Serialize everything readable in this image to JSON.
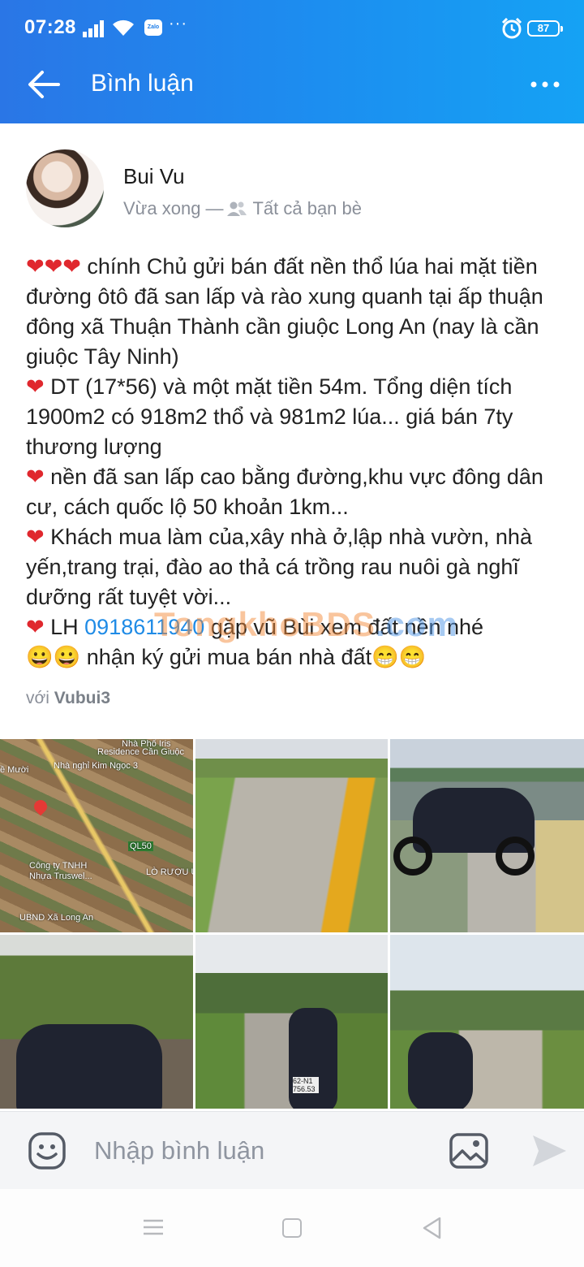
{
  "status_bar": {
    "time": "07:28",
    "notification_app": "Zalo",
    "more_indicator": "···",
    "battery": "87",
    "icons": [
      "signal-icon",
      "wifi-icon",
      "zalo-icon",
      "alarm-icon",
      "battery-icon"
    ]
  },
  "header": {
    "title": "Bình luận",
    "back_icon": "back-arrow-icon",
    "more_icon": "more-horizontal-icon",
    "gradient_colors": [
      "#2a76e6",
      "#15a2f4"
    ]
  },
  "post": {
    "author": "Bui Vu",
    "time": "Vừa xong",
    "separator": "—",
    "privacy": "Tất cả bạn bè",
    "lines": [
      {
        "hearts": "❤❤❤",
        "text": " chính Chủ gửi bán đất nền thổ lúa hai mặt tiền đường ôtô đã san lấp và rào xung quanh tại ấp thuận đông xã Thuận Thành cần giuộc Long An (nay là cần giuộc Tây Ninh)"
      },
      {
        "hearts": "❤",
        "text": " DT (17*56) và một mặt tiền 54m. Tổng diện tích 1900m2 có 918m2 thổ và 981m2 lúa... giá bán 7ty thương lượng"
      },
      {
        "hearts": "❤",
        "text": " nền đã san lấp cao bằng đường,khu vực đông dân cư, cách quốc lộ 50 khoản 1km..."
      },
      {
        "hearts": "❤",
        "text": " Khách mua làm của,xây nhà ở,lập nhà vườn, nhà yến,trang trại, đào ao thả cá trồng rau nuôi gà nghĩ dưỡng rất tuyệt vời..."
      }
    ],
    "contact_hearts": "❤",
    "contact_prefix": " LH ",
    "phone": "0918611940",
    "contact_suffix": " gặp vũ Bùi xem đất nền nhé",
    "closing_start": "😀😀",
    "closing_text": " nhận ký gửi mua bán nhà đất",
    "closing_end": "😁😁",
    "tag_prefix": "với ",
    "tag_name": "Vubui3",
    "watermark": "TongkhoBDS",
    "watermark_suffix": ".com",
    "heart_color": "#e0282e",
    "link_color": "#1f8be6"
  },
  "photos": {
    "map_labels": [
      "Nhà Phố Iris",
      "Residence Cần Giuộc",
      "Nhà nghỉ Kim Ngọc 3",
      "Công ty TNHH",
      "Nhựa Truswel...",
      "UBND Xã Long An",
      "LÒ RƯỢU Ú",
      "QL50",
      "ề Mười"
    ],
    "plate": "62-N1 756.53",
    "items": [
      "map-photo",
      "road-photo",
      "motorbike-photo-1",
      "motorbike-photo-2",
      "motorbike-photo-3",
      "motorbike-photo-4"
    ]
  },
  "comment_bar": {
    "placeholder": "Nhập bình luận",
    "emoji_icon": "emoji-icon",
    "image_icon": "image-icon",
    "send_icon": "send-icon"
  },
  "nav_bar": {
    "icons": [
      "menu-icon",
      "home-icon",
      "back-icon"
    ]
  }
}
